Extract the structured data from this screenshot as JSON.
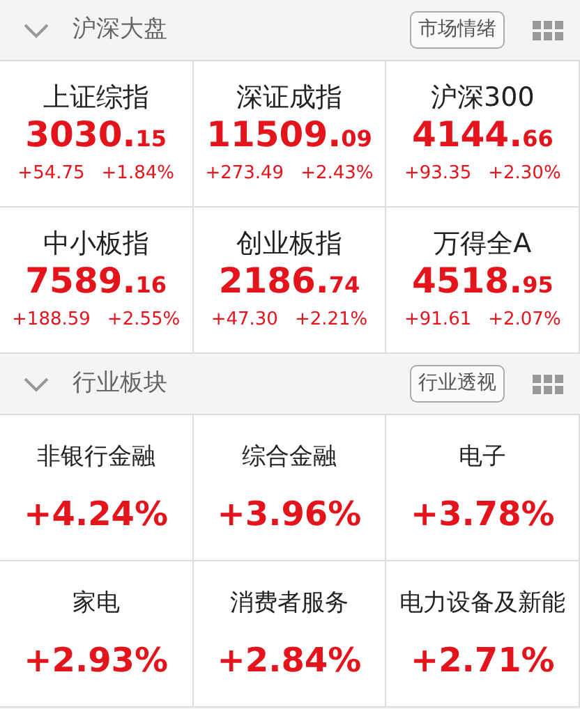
{
  "sections": [
    {
      "kind": "index",
      "title": "沪深大盘",
      "expanded": true,
      "action": "市场情绪",
      "items": [
        {
          "name": "上证综指",
          "price_int": "3030.",
          "price_frac": "15",
          "change": "+54.75",
          "percent": "+1.84%"
        },
        {
          "name": "深证成指",
          "price_int": "11509.",
          "price_frac": "09",
          "change": "+273.49",
          "percent": "+2.43%"
        },
        {
          "name": "沪深300",
          "price_int": "4144.",
          "price_frac": "66",
          "change": "+93.35",
          "percent": "+2.30%"
        },
        {
          "name": "中小板指",
          "price_int": "7589.",
          "price_frac": "16",
          "change": "+188.59",
          "percent": "+2.55%"
        },
        {
          "name": "创业板指",
          "price_int": "2186.",
          "price_frac": "74",
          "change": "+47.30",
          "percent": "+2.21%"
        },
        {
          "name": "万得全A",
          "price_int": "4518.",
          "price_frac": "95",
          "change": "+91.61",
          "percent": "+2.07%"
        }
      ]
    },
    {
      "kind": "sector",
      "title": "行业板块",
      "expanded": true,
      "action": "行业透视",
      "items": [
        {
          "name": "非银行金融",
          "percent": "+4.24%"
        },
        {
          "name": "综合金融",
          "percent": "+3.96%"
        },
        {
          "name": "电子",
          "percent": "+3.78%"
        },
        {
          "name": "家电",
          "percent": "+2.93%"
        },
        {
          "name": "消费者服务",
          "percent": "+2.84%"
        },
        {
          "name": "电力设备及新能",
          "percent": "+2.71%"
        }
      ]
    }
  ]
}
